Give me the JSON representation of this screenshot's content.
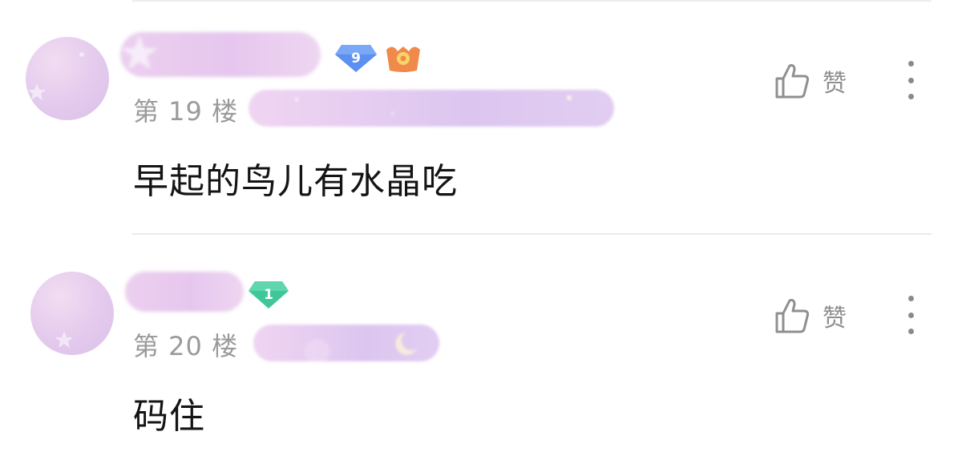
{
  "comments": [
    {
      "floor": "第 19 楼",
      "text": "早起的鸟儿有水晶吃",
      "level": "9",
      "like_label": "赞",
      "colors": {
        "level_badge": "#5b8ff0",
        "vip_badge": "#f08a4b"
      }
    },
    {
      "floor": "第 20 楼",
      "text": "码住",
      "level": "1",
      "like_label": "赞",
      "colors": {
        "level_badge": "#3fc79a"
      }
    }
  ],
  "icons": {
    "like": "thumbs-up-icon",
    "more": "more-vertical-icon",
    "level_badge": "diamond-level-icon",
    "vip_badge": "crown-badge-icon"
  },
  "colors": {
    "divider": "#ececec",
    "meta_text": "#9a9a9a",
    "content_text": "#141414"
  }
}
